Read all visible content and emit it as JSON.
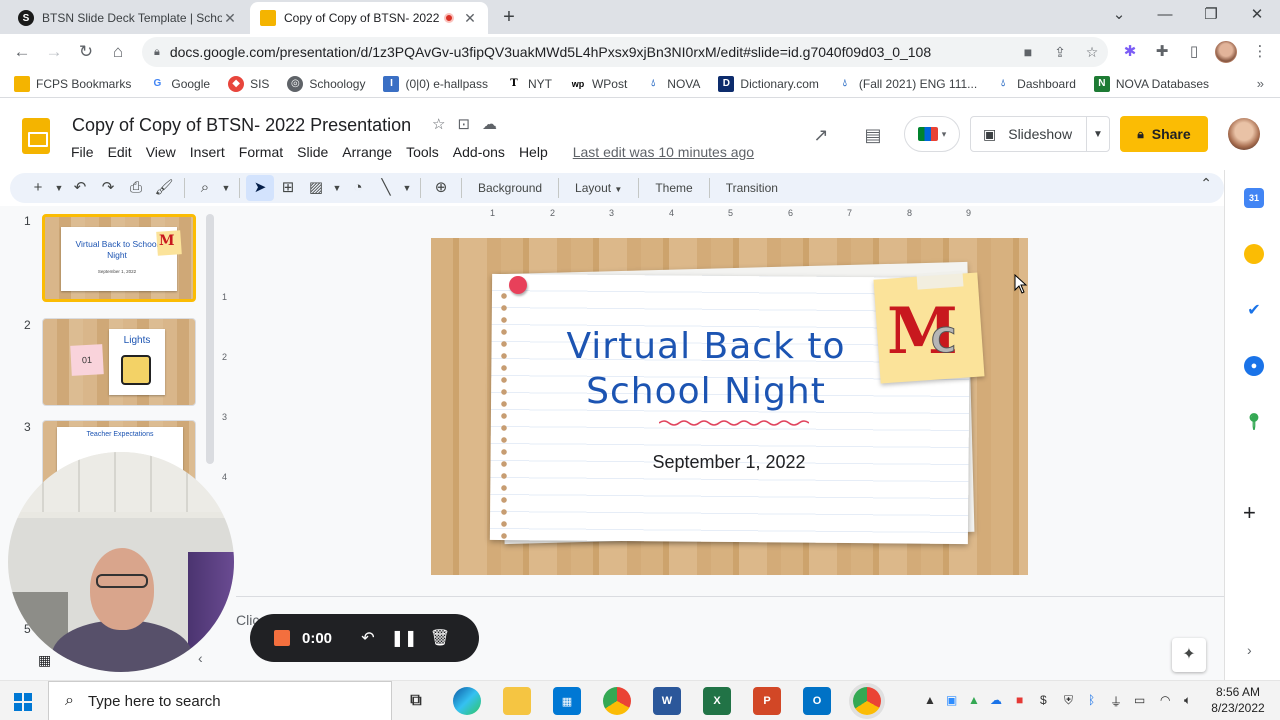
{
  "browser": {
    "tabs": [
      {
        "title": "BTSN Slide Deck Template | Scho",
        "favicon": "S",
        "active": false
      },
      {
        "title": "Copy of Copy of BTSN- 2022",
        "favicon": "slides",
        "active": true
      }
    ],
    "url": "docs.google.com/presentation/d/1z3PQAvGv-u3fipQV3uakMWd5L4hPxsx9xjBn3NI0rxM/edit#slide=id.g7040f09d03_0_108",
    "bookmarks": [
      "FCPS Bookmarks",
      "Google",
      "SIS",
      "Schoology",
      "(0|0) e-hallpass",
      "NYT",
      "WPost",
      "NOVA",
      "Dictionary.com",
      "(Fall 2021) ENG 111...",
      "Dashboard",
      "NOVA Databases"
    ]
  },
  "app": {
    "doc_title": "Copy of Copy of BTSN- 2022 Presentation",
    "menu": [
      "File",
      "Edit",
      "View",
      "Insert",
      "Format",
      "Slide",
      "Arrange",
      "Tools",
      "Add-ons",
      "Help"
    ],
    "last_edit": "Last edit was 10 minutes ago",
    "slideshow_label": "Slideshow",
    "share_label": "Share",
    "accent": "#fbbc04"
  },
  "toolbar": {
    "background": "Background",
    "layout": "Layout",
    "theme": "Theme",
    "transition": "Transition"
  },
  "rulers": {
    "top": [
      "1",
      "2",
      "3",
      "4",
      "5",
      "6",
      "7",
      "8",
      "9"
    ],
    "left": [
      "1",
      "2",
      "3",
      "4"
    ]
  },
  "filmstrip": {
    "slides": [
      {
        "num": "1",
        "title": "Virtual Back to School Night",
        "date": "September 1, 2022"
      },
      {
        "num": "2",
        "badge": "01",
        "title": "Lights"
      },
      {
        "num": "3",
        "title": "Teacher Expectations"
      }
    ],
    "slide5_num": "5"
  },
  "slide": {
    "title_line1": "Virtual Back to",
    "title_line2": "School Night",
    "date": "September 1, 2022",
    "logo_m": "M",
    "logo_c": "C"
  },
  "notes": {
    "placeholder_partial": "Clic"
  },
  "recorder": {
    "time": "0:00",
    "stop_color": "#f36f3e"
  },
  "taskbar": {
    "search_placeholder": "Type here to search",
    "time": "8:56 AM",
    "date": "8/23/2022"
  }
}
